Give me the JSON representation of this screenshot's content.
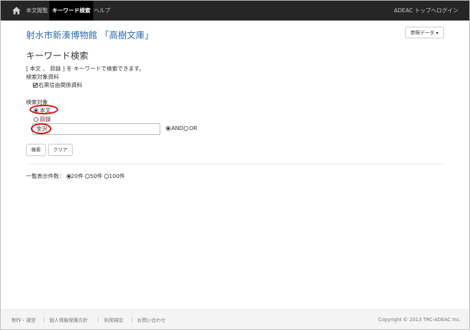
{
  "navbar": {
    "items": [
      "本文閲覧",
      "キーワード検索",
      "ヘルプ"
    ],
    "right": [
      "ADEAC トップへ",
      "ログイン"
    ]
  },
  "site_title": "射水市新湊博物館 「高樹文庫」",
  "reference_button": "参照データ",
  "heading": "キーワード検索",
  "description": "[ 本文 、 目録 ] を キーワードで検索できます。",
  "material": {
    "label": "検索対象資料",
    "option": "石黒信由関係資料"
  },
  "target": {
    "label": "検索対象",
    "options": [
      "本文",
      "目録"
    ],
    "selected": "本文"
  },
  "keyword": {
    "value": "金沢"
  },
  "logic": {
    "options": [
      "AND",
      "OR"
    ],
    "selected": "AND"
  },
  "buttons": {
    "search": "検索",
    "clear": "クリア"
  },
  "per_page": {
    "label": "一覧表示件数：",
    "options": [
      "20件",
      "50件",
      "100件"
    ],
    "selected": "20件"
  },
  "footer": {
    "links": [
      "制作・運営",
      "個人情報保護方針",
      "利用規定",
      "お問い合わせ"
    ],
    "copyright": "Copyright © 2013 TRC-ADEAC Inc."
  },
  "colors": {
    "navbar_bg": "#262626",
    "title_blue": "#2a6cb0",
    "highlight_red": "#e00000"
  }
}
